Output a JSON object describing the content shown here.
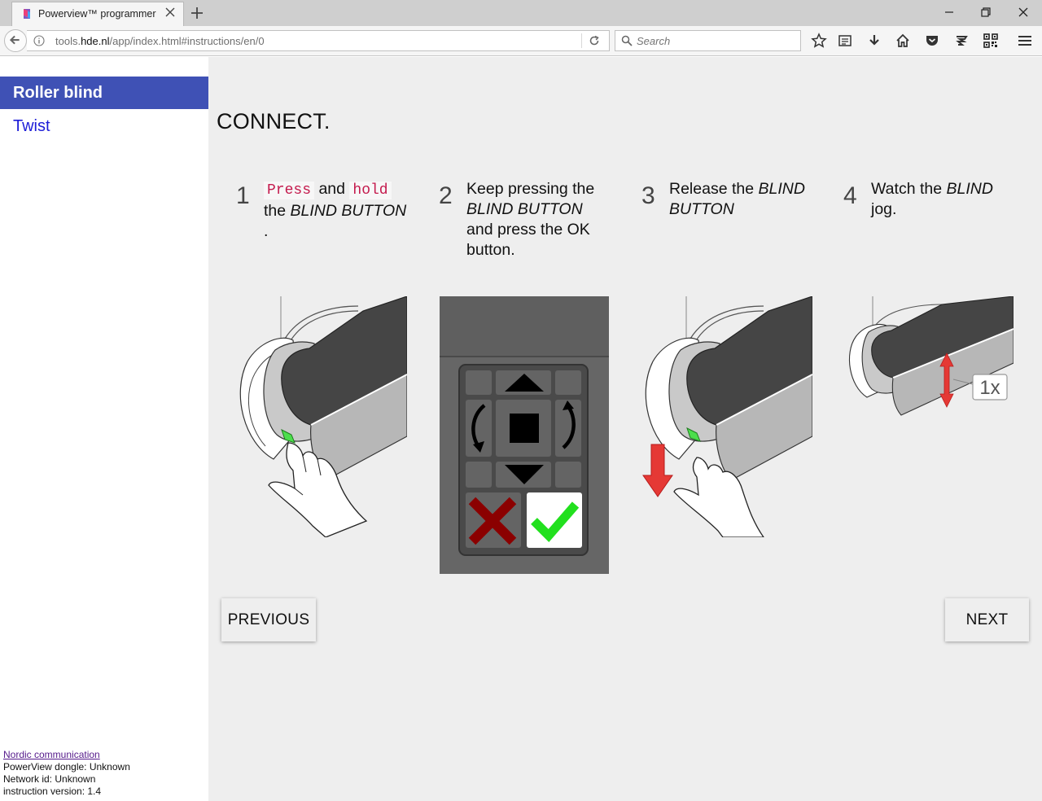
{
  "browser": {
    "tab_title": "Powerview™ programmer",
    "url_domain_prefix": "tools.",
    "url_domain": "hde.nl",
    "url_path": "/app/index.html#instructions/en/0",
    "search_placeholder": "Search"
  },
  "sidebar": {
    "items": [
      {
        "label": "Roller blind",
        "active": true
      },
      {
        "label": "Twist",
        "active": false
      }
    ],
    "info": {
      "link": "Nordic communication",
      "dongle": "PowerView dongle: Unknown",
      "network": "Network id: Unknown",
      "version": "instruction version: 1.4"
    }
  },
  "main": {
    "heading": "CONNECT.",
    "steps": [
      {
        "number": "1",
        "code1": "Press",
        "and": "and",
        "code2": "hold",
        "rest": "the ",
        "em": "BLIND BUTTON",
        "tail": "."
      },
      {
        "number": "2",
        "a": "Keep pressing the ",
        "em": "BLIND BUTTON",
        "b": " and press the OK button."
      },
      {
        "number": "3",
        "a": "Release the ",
        "em": "BLIND BUTTON"
      },
      {
        "number": "4",
        "a": "Watch the ",
        "em": "BLIND",
        "b": " jog."
      }
    ],
    "jog_label": "1x",
    "previous_label": "PREVIOUS",
    "next_label": "NEXT"
  },
  "colors": {
    "accent": "#3f51b5",
    "link": "#1d1dd8",
    "cancel": "#8b0000",
    "ok": "#22e01e"
  }
}
